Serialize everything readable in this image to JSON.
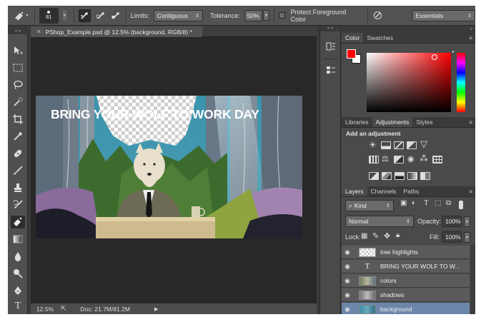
{
  "options_bar": {
    "brush_size": "81",
    "limits_label": "Limits:",
    "limits_value": "Contiguous",
    "tolerance_label": "Tolerance:",
    "tolerance_value": "50%",
    "protect_label": "Protect Foreground Color",
    "workspace": "Essentials"
  },
  "document": {
    "tab_title": "PShop_Example.psd @ 12.5% (background, RGB/8) *",
    "canvas_headline": "BRING YOUR WOLF TO WORK DAY"
  },
  "status": {
    "zoom": "12.5%",
    "doc_info": "Doc: 21.7M/81.2M"
  },
  "color_panel": {
    "tabs": [
      "Color",
      "Swatches"
    ],
    "foreground": "#ff0000",
    "background": "#ffffff"
  },
  "adjust_panel": {
    "tabs": [
      "Libraries",
      "Adjustments",
      "Styles"
    ],
    "heading": "Add an adjustment"
  },
  "layers_panel": {
    "tabs": [
      "Layers",
      "Channels",
      "Paths"
    ],
    "kind": "Kind",
    "blend_mode": "Normal",
    "opacity_label": "Opacity:",
    "opacity_value": "100%",
    "lock_label": "Lock:",
    "fill_label": "Fill:",
    "fill_value": "100%",
    "layers": [
      {
        "name": "tree highlights",
        "type": "raster"
      },
      {
        "name": "BRING YOUR WOLF TO W...",
        "type": "text"
      },
      {
        "name": "colors",
        "type": "raster"
      },
      {
        "name": "shadows",
        "type": "raster"
      },
      {
        "name": "background",
        "type": "raster",
        "selected": true
      }
    ]
  },
  "colors": {
    "ui_bg": "#3b3b3b",
    "panel_bg": "#4a4a4a",
    "selection_blue": "#6b86a8"
  }
}
